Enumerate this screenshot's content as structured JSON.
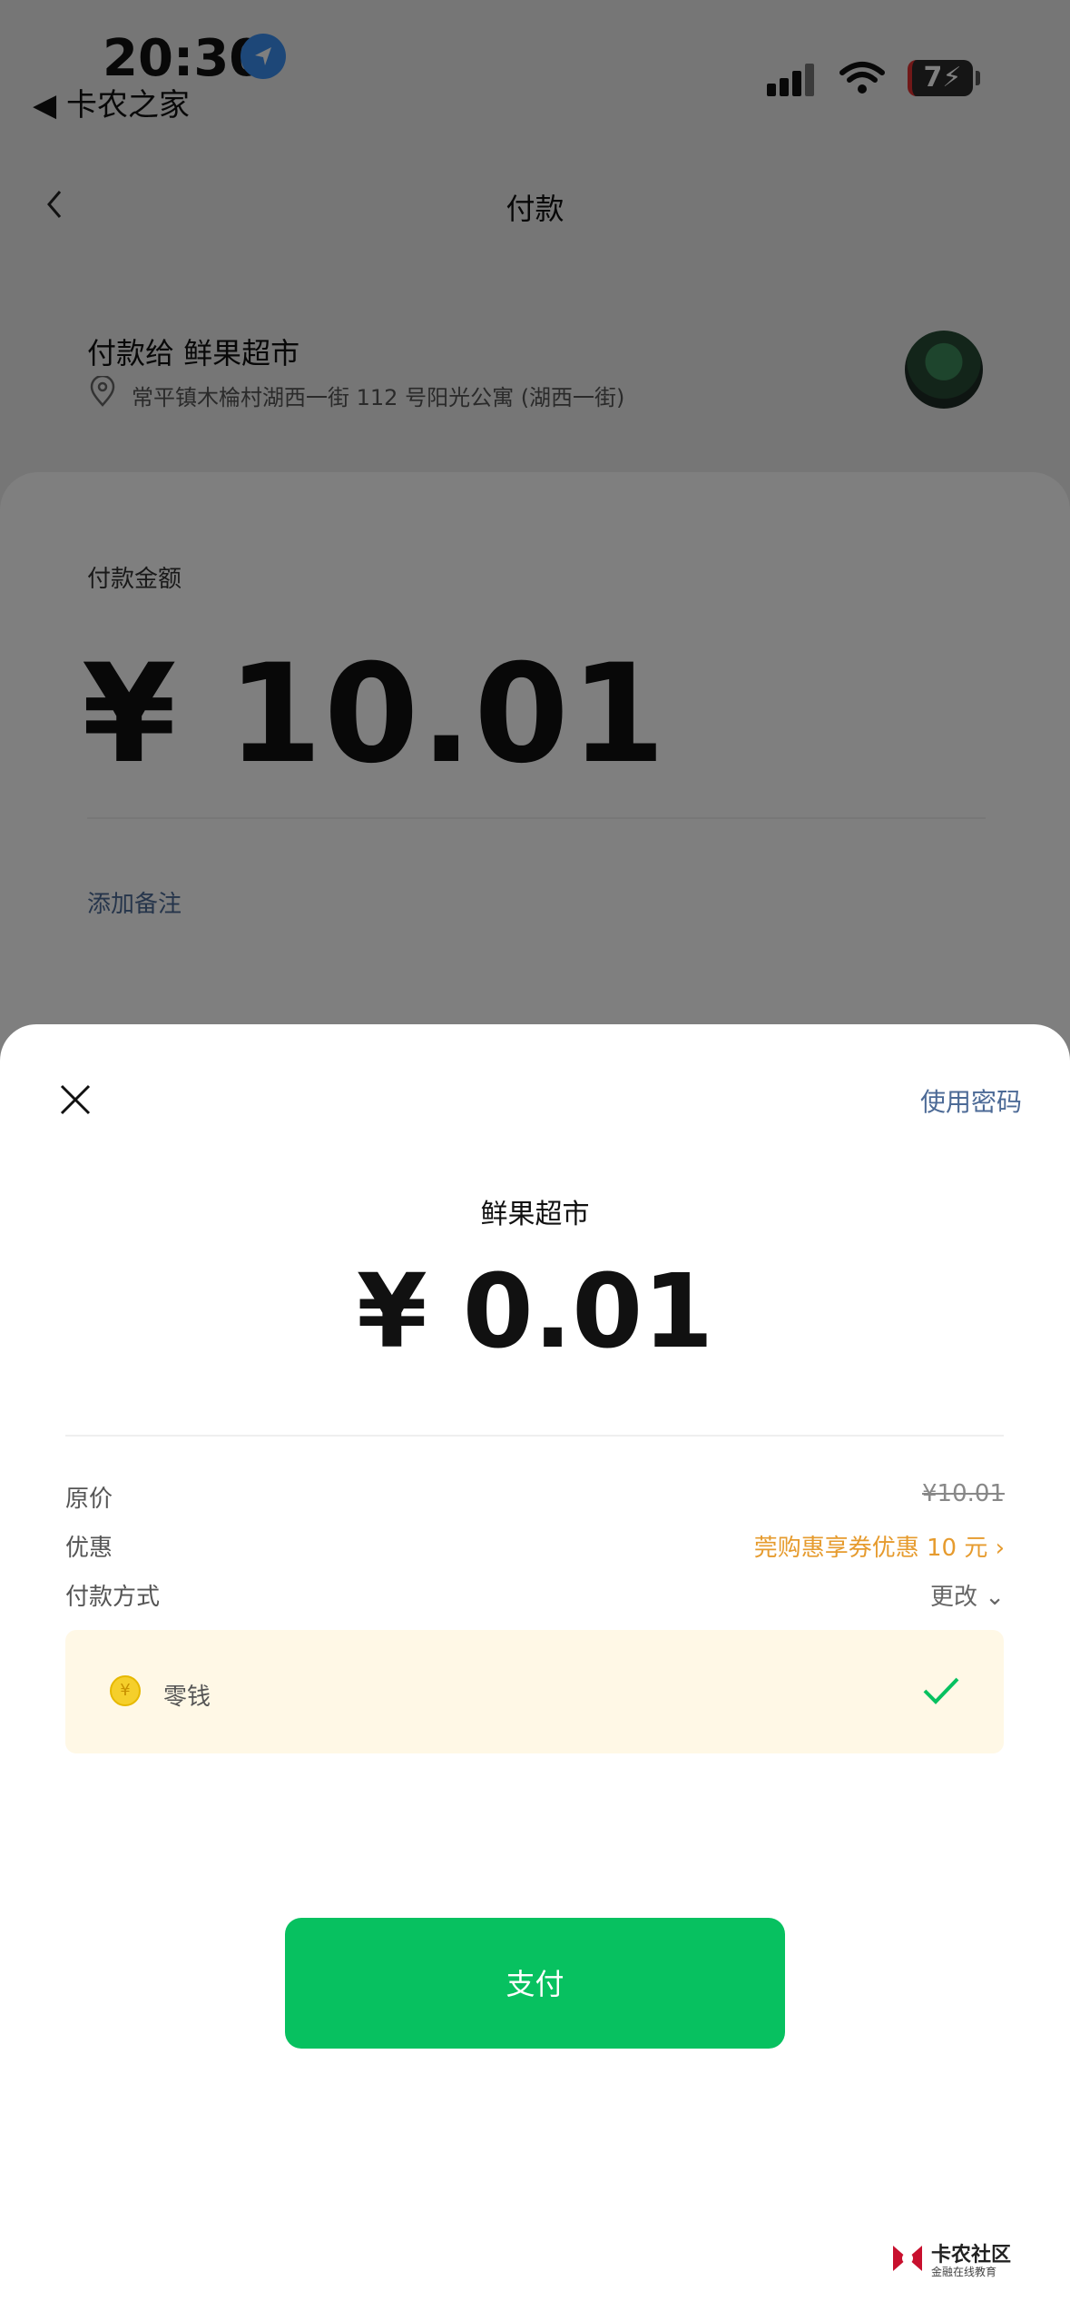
{
  "status_bar": {
    "time": "20:30",
    "back_app": "◀ 卡农之家",
    "battery": "7"
  },
  "nav": {
    "title": "付款"
  },
  "payee": {
    "label": "付款给  鲜果超市",
    "address": "常平镇木棆村湖西一街 112 号阳光公寓 (湖西一街)"
  },
  "amount_card": {
    "label": "付款金额",
    "amount": "¥ 10.01",
    "add_note": "添加备注"
  },
  "sheet": {
    "use_password": "使用密码",
    "merchant": "鲜果超市",
    "amount": "¥ 0.01",
    "rows": {
      "original_label": "原价",
      "original_value": "¥10.01",
      "discount_label": "优惠",
      "discount_value": "莞购惠享券优惠 10 元 ›",
      "method_label": "付款方式",
      "method_value": "更改 ⌄"
    },
    "method": {
      "name": "零钱",
      "coin": "¥"
    },
    "pay_button": "支付"
  },
  "watermark": {
    "title": "卡农社区",
    "subtitle": "金融在线教育"
  },
  "colors": {
    "accent_green": "#07c160",
    "link_blue": "#4c6a96",
    "discount_orange": "#e69b2e",
    "method_bg": "#fff8e6"
  }
}
